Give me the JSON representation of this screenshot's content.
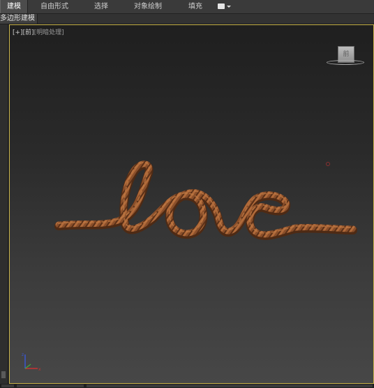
{
  "menu": {
    "tabs": [
      {
        "label": "建模",
        "active": true
      },
      {
        "label": "自由形式",
        "active": false
      },
      {
        "label": "选择",
        "active": false
      },
      {
        "label": "对象绘制",
        "active": false
      },
      {
        "label": "填充",
        "active": false
      }
    ],
    "dropdown_icon": "panel-dropdown-icon"
  },
  "ribbon": {
    "panel_tab": "多边形建模"
  },
  "viewport": {
    "label_plus": "[+]",
    "label_view": "[前]",
    "label_shading": "[明暗处理]",
    "viewcube_face": "前",
    "object_text": "love",
    "colors": {
      "rope": "#8a4f2a",
      "rope_highlight": "#b06a3a",
      "rope_shadow": "#4e2a14",
      "border": "#c9b44a",
      "axis_x": "#c83232",
      "axis_y": "#3cae3c",
      "axis_z": "#3a57d0"
    }
  }
}
